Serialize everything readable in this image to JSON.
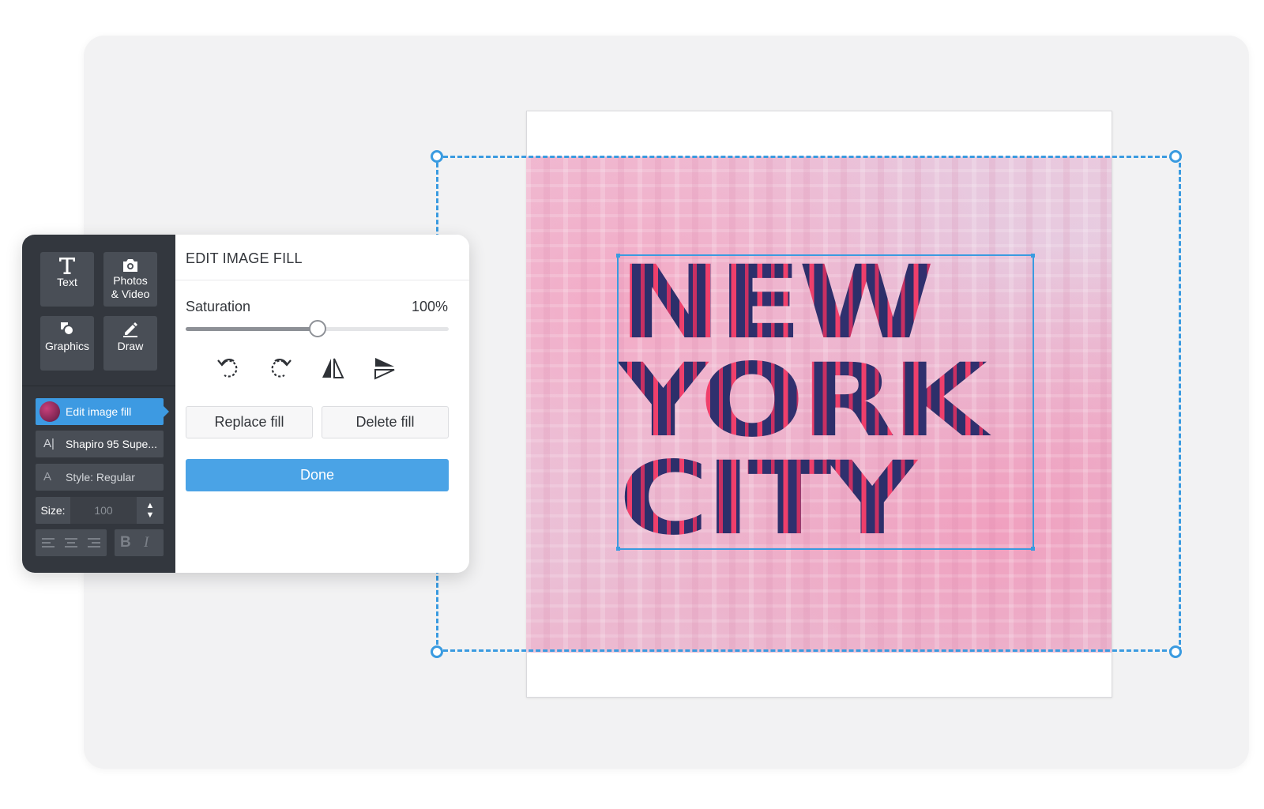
{
  "toolbar": {
    "text_label": "Text",
    "photos_label_1": "Photos",
    "photos_label_2": "& Video",
    "graphics_label": "Graphics",
    "draw_label": "Draw"
  },
  "properties": {
    "edit_image_fill": "Edit image fill",
    "font_name": "Shapiro 95 Supe...",
    "style": "Style: Regular",
    "size_label": "Size:",
    "size_value": "100"
  },
  "edit_fill": {
    "title": "EDIT IMAGE FILL",
    "saturation_label": "Saturation",
    "saturation_value": "100%",
    "saturation_level": 1.0,
    "replace_label": "Replace fill",
    "delete_label": "Delete fill",
    "done_label": "Done",
    "icons": [
      "rotate-left-icon",
      "rotate-right-icon",
      "flip-horizontal-icon",
      "flip-vertical-icon"
    ]
  },
  "canvas": {
    "line1": "NEW",
    "line2": "YORK",
    "line3": "CITY"
  },
  "colors": {
    "accent": "#4aa3e6",
    "selection": "#3a9be0",
    "toolbar_bg": "#33373e",
    "text_fill_dark": "#2d2f6a",
    "text_fill_pink": "#ef3f6b"
  }
}
